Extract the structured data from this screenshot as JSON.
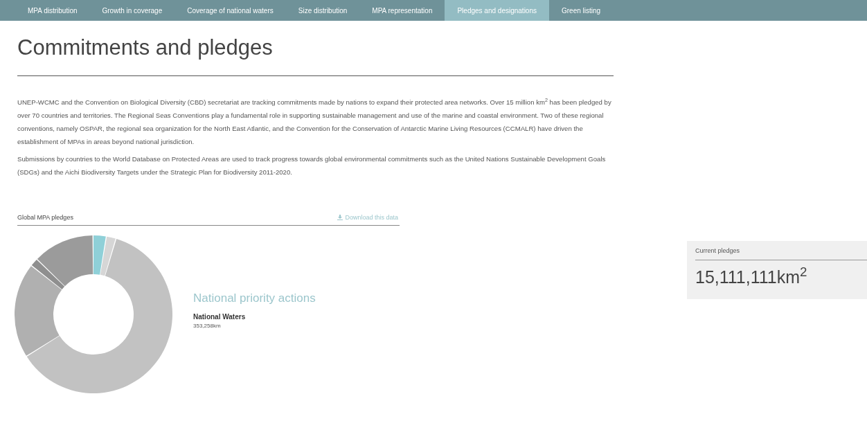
{
  "nav_tabs": [
    {
      "label": "MPA distribution",
      "selected": false
    },
    {
      "label": "Growth in coverage",
      "selected": false
    },
    {
      "label": "Coverage of national waters",
      "selected": false
    },
    {
      "label": "Size distribution",
      "selected": false
    },
    {
      "label": "MPA representation",
      "selected": false
    },
    {
      "label": "Pledges and designations",
      "selected": true
    },
    {
      "label": "Green listing",
      "selected": false
    }
  ],
  "title": "Commitments and pledges",
  "paragraphs": [
    "UNEP-WCMC and the Convention on Biological Diversity (CBD) secretariat are tracking commitments made by nations to expand their protected area networks. Over 15 million km$^{2}$ has been pledged by over 70 countries and territories. The Regional Seas Conventions play a fundamental role in supporting sustainable management and use of the marine and coastal environment. Two of these regional conventions, namely OSPAR, the regional sea organization for the North East Atlantic, and the Convention for the Conservation of Antarctic Marine Living Resources (CCMALR) have driven the establishment of MPAs in areas beyond national jurisdiction.",
    "Submissions by countries to the World Database on Protected Areas are used to track progress towards global environmental commitments such as the United Nations Sustainable Development Goals (SDGs) and the Aichi Biodiversity Targets under the Strategic Plan for Biodiversity 2011-2020."
  ],
  "chart_panel": {
    "title": "Global MPA pledges",
    "download_link": "Download this data",
    "category": "National priority actions",
    "item_name": "National Waters",
    "item_value": "353,258km"
  },
  "summary_card": {
    "label": "Current pledges",
    "value": "15,111,111km$^{2}$"
  }
}
